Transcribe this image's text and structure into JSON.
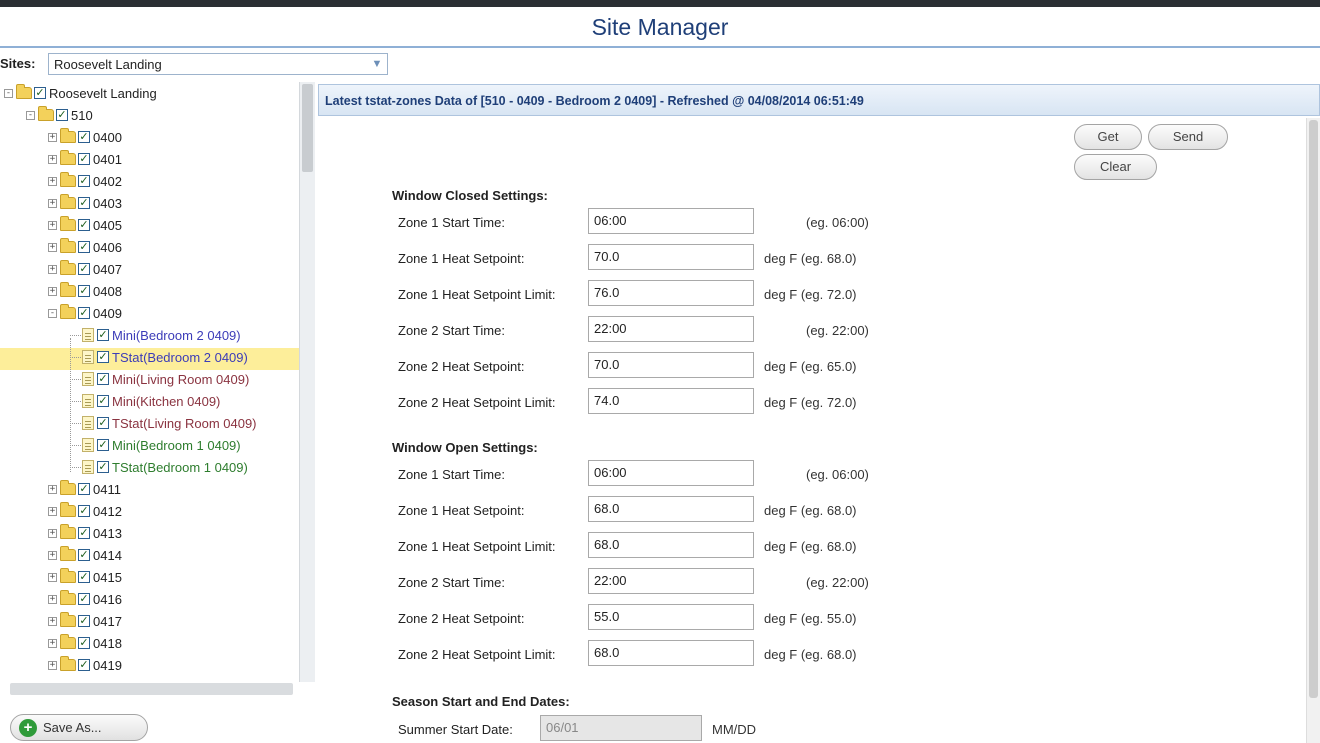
{
  "app": {
    "title": "Site Manager"
  },
  "sites": {
    "label": "Sites:",
    "selected": "Roosevelt Landing"
  },
  "tree": {
    "root": "Roosevelt Landing",
    "building": "510",
    "units_above": [
      "0400",
      "0401",
      "0402",
      "0403",
      "0405",
      "0406",
      "0407",
      "0408"
    ],
    "open_unit": "0409",
    "devices": [
      {
        "label": "Mini(Bedroom 2 0409)",
        "color": "blue"
      },
      {
        "label": "TStat(Bedroom 2 0409)",
        "color": "blue",
        "selected": true
      },
      {
        "label": "Mini(Living Room 0409)",
        "color": "maroon"
      },
      {
        "label": "Mini(Kitchen 0409)",
        "color": "maroon"
      },
      {
        "label": "TStat(Living Room 0409)",
        "color": "maroon"
      },
      {
        "label": "Mini(Bedroom 1 0409)",
        "color": "green"
      },
      {
        "label": "TStat(Bedroom 1 0409)",
        "color": "green"
      }
    ],
    "units_below": [
      "0411",
      "0412",
      "0413",
      "0414",
      "0415",
      "0416",
      "0417",
      "0418",
      "0419"
    ]
  },
  "save_as": {
    "label": "Save As..."
  },
  "panel": {
    "header": "Latest tstat-zones Data of [510 - 0409 - Bedroom 2 0409] - Refreshed @ 04/08/2014 06:51:49",
    "buttons": {
      "get": "Get",
      "send": "Send",
      "clear": "Clear"
    }
  },
  "window_closed": {
    "title": "Window Closed Settings:",
    "rows": [
      {
        "label": "Zone 1 Start Time:",
        "value": "06:00",
        "hint": "(eg. 06:00)"
      },
      {
        "label": "Zone 1 Heat Setpoint:",
        "value": "70.0",
        "hint": "deg F (eg. 68.0)"
      },
      {
        "label": "Zone 1 Heat Setpoint Limit:",
        "value": "76.0",
        "hint": "deg F (eg. 72.0)"
      },
      {
        "label": "Zone 2 Start Time:",
        "value": "22:00",
        "hint": "(eg. 22:00)"
      },
      {
        "label": "Zone 2 Heat Setpoint:",
        "value": "70.0",
        "hint": "deg F (eg. 65.0)"
      },
      {
        "label": "Zone 2 Heat Setpoint Limit:",
        "value": "74.0",
        "hint": "deg F (eg. 72.0)"
      }
    ]
  },
  "window_open": {
    "title": "Window Open Settings:",
    "rows": [
      {
        "label": "Zone 1 Start Time:",
        "value": "06:00",
        "hint": "(eg. 06:00)"
      },
      {
        "label": "Zone 1 Heat Setpoint:",
        "value": "68.0",
        "hint": "deg F (eg. 68.0)"
      },
      {
        "label": "Zone 1 Heat Setpoint Limit:",
        "value": "68.0",
        "hint": "deg F (eg. 68.0)"
      },
      {
        "label": "Zone 2 Start Time:",
        "value": "22:00",
        "hint": "(eg. 22:00)"
      },
      {
        "label": "Zone 2 Heat Setpoint:",
        "value": "55.0",
        "hint": "deg F (eg. 55.0)"
      },
      {
        "label": "Zone 2 Heat Setpoint Limit:",
        "value": "68.0",
        "hint": "deg F (eg. 68.0)"
      }
    ]
  },
  "season": {
    "title": "Season Start and End Dates:",
    "summer_label": "Summer Start Date:",
    "summer_value": "06/01",
    "summer_hint": "MM/DD"
  }
}
